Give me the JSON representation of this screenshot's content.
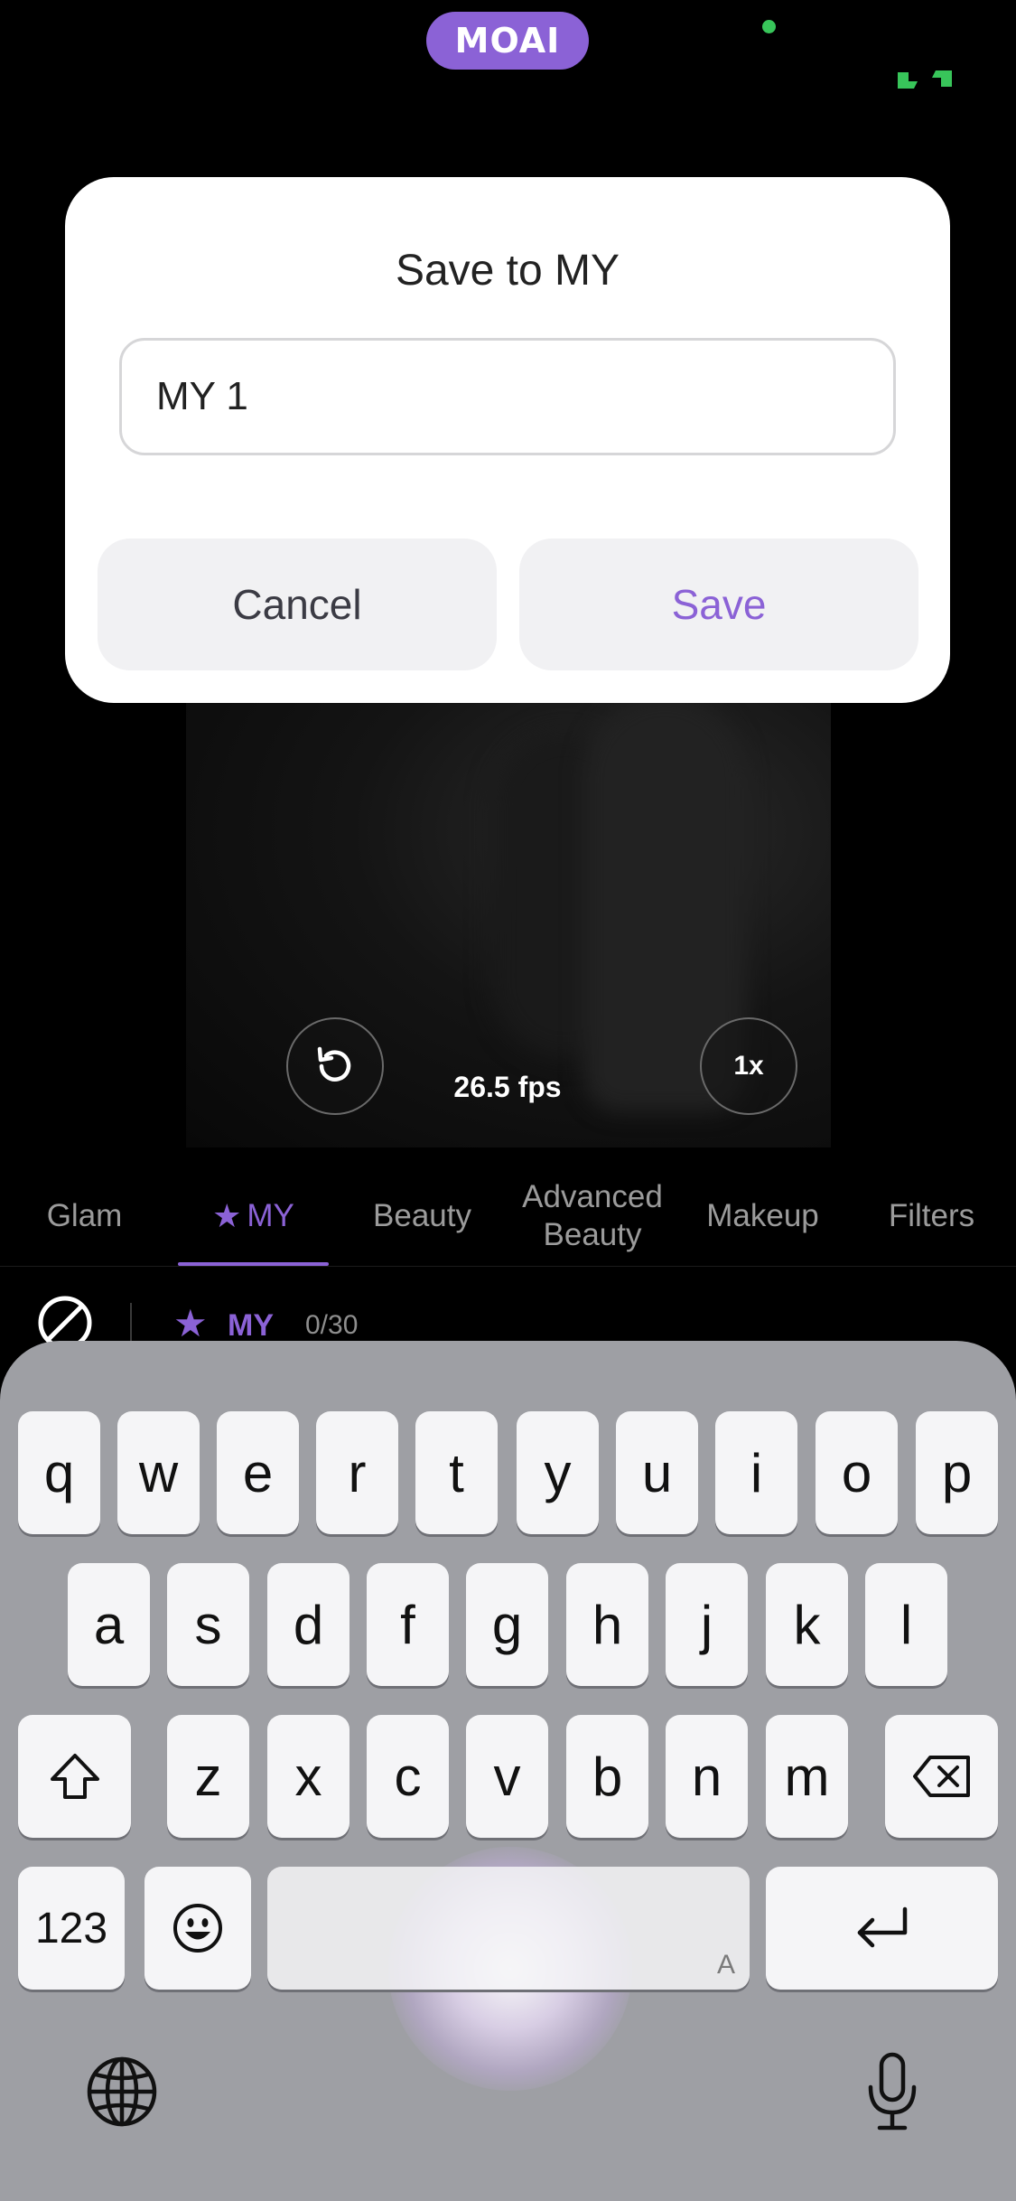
{
  "top_bar": {
    "logo_text": "MOAI",
    "accent_color": "#8b62d6",
    "status_dot_color": "#38c55a",
    "icon": "camera-switch-icon"
  },
  "preview": {
    "fps_label": "26.5 fps",
    "zoom_label": "1x",
    "reset_icon": "rotate-ccw-icon"
  },
  "tabs": [
    {
      "label": "Glam",
      "active": false
    },
    {
      "label": "MY",
      "active": true,
      "icon": "star-icon"
    },
    {
      "label": "Beauty",
      "active": false
    },
    {
      "label": "Advanced Beauty",
      "active": false
    },
    {
      "label": "Makeup",
      "active": false
    },
    {
      "label": "Filters",
      "active": false
    }
  ],
  "sub_row": {
    "none_icon": "prohibited-icon",
    "label": "MY",
    "count": "0/30"
  },
  "dialog": {
    "title": "Save to MY",
    "input_value": "MY 1",
    "cancel_label": "Cancel",
    "save_label": "Save"
  },
  "keyboard": {
    "row1": [
      "q",
      "w",
      "e",
      "r",
      "t",
      "y",
      "u",
      "i",
      "o",
      "p"
    ],
    "row2": [
      "a",
      "s",
      "d",
      "f",
      "g",
      "h",
      "j",
      "k",
      "l"
    ],
    "row3": [
      "z",
      "x",
      "c",
      "v",
      "b",
      "n",
      "m"
    ],
    "numbers_label": "123",
    "space_hint": "A",
    "icons": [
      "shift-icon",
      "backspace-icon",
      "emoji-icon",
      "return-icon",
      "globe-icon",
      "microphone-icon"
    ]
  }
}
